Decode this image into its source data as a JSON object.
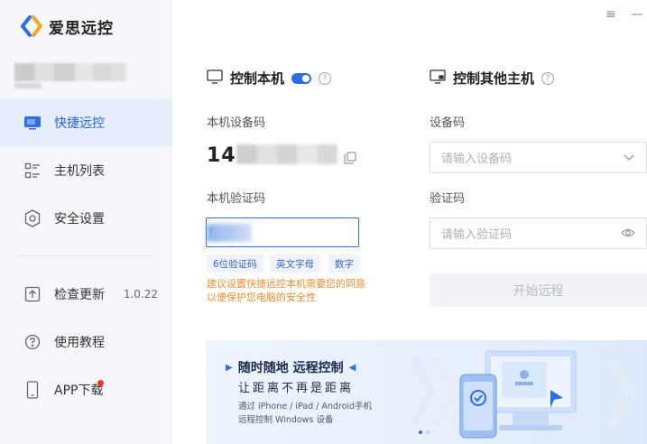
{
  "app": {
    "name": "爱思远控"
  },
  "sidebar": {
    "items": [
      {
        "label": "快捷远控",
        "icon": "monitor-icon",
        "active": true
      },
      {
        "label": "主机列表",
        "icon": "list-icon"
      },
      {
        "label": "安全设置",
        "icon": "shield-icon"
      },
      {
        "label": "检查更新",
        "icon": "update-icon",
        "version": "1.0.22"
      },
      {
        "label": "使用教程",
        "icon": "help-icon"
      },
      {
        "label": "APP下载",
        "icon": "phone-icon",
        "badge": "red-dot"
      }
    ]
  },
  "window": {
    "menu_icon": "≡",
    "minimize_icon": "—"
  },
  "local": {
    "title": "控制本机",
    "toggle_on": true,
    "device_code_label": "本机设备码",
    "device_code_visible": "14",
    "verify_label": "本机验证码",
    "verify_value": "r",
    "chips": [
      "6位验证码",
      "英文字母",
      "数字"
    ],
    "warning_line1": "建议设置快捷远控本机需要您的同意",
    "warning_line2": "以便保护您电脑的安全性"
  },
  "remote": {
    "title": "控制其他主机",
    "device_code_label": "设备码",
    "device_code_placeholder": "请输入设备码",
    "verify_label": "验证码",
    "verify_placeholder": "请输入验证码",
    "start_button": "开始远程"
  },
  "banner": {
    "title": "随时随地 远程控制",
    "subtitle": "让距离不再是距离",
    "desc_line1": "通过 iPhone / iPad / Android手机",
    "desc_line2": "远程控制 Windows 设备"
  },
  "colors": {
    "accent": "#2a6ee8",
    "warning": "#f08c2e",
    "badge": "#f0341a"
  }
}
